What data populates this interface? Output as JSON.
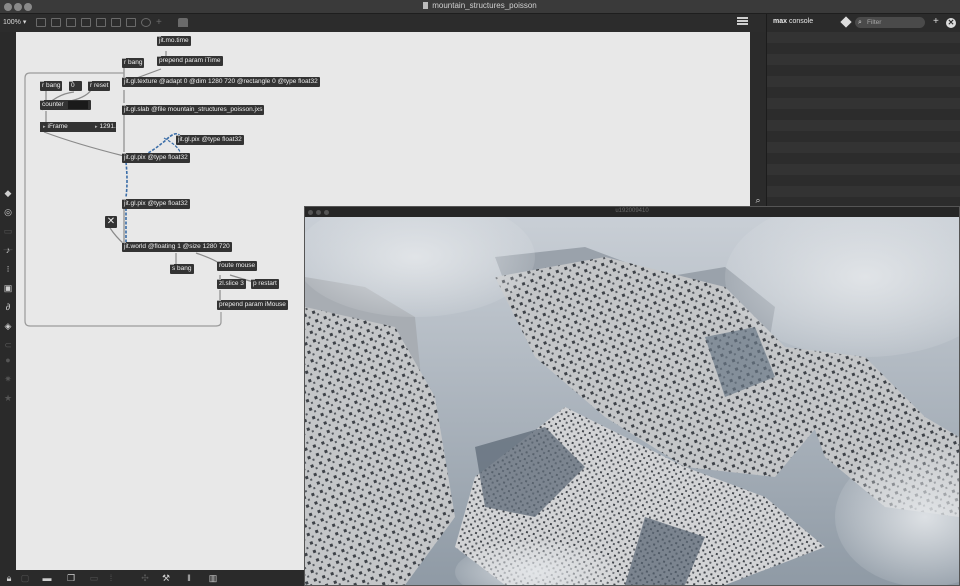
{
  "window": {
    "title": "mountain_structures_poisson"
  },
  "toolbar": {
    "zoom": "100%",
    "zoom_caret": "▾"
  },
  "patcher": {
    "objects": {
      "jit_mo_time": "jit.mo.time",
      "prepend_itime": "prepend param iTime",
      "r_bang_top": "r bang",
      "jit_gl_texture": "jit.gl.texture @adapt 0 @dim 1280 720 @rectangle 0 @type float32",
      "r_bang": "r bang",
      "num_zero": "0",
      "r_reset": "r reset",
      "counter": "counter",
      "jit_gl_slab": "jit.gl.slab @file mountain_structures_poisson.jxs",
      "iframe_label": "iFrame",
      "iframe_value": "1291.",
      "jit_gl_pix_a": "jit.gl.pix @type float32",
      "jit_gl_pix_b": "jit.gl.pix @type float32",
      "jit_gl_pix_c": "jit.gl.pix @type float32",
      "toggle": "✕",
      "jit_world": "jit.world @floating 1 @size 1280 720",
      "s_bang": "s bang",
      "route_mouse": "route mouse",
      "zl_slice": "zl.slice 3",
      "p_restart": "p restart",
      "prepend_imouse": "prepend param iMouse"
    }
  },
  "console": {
    "title_bold": "max",
    "title_rest": " console",
    "filter_placeholder": "Filter",
    "add_label": "+",
    "close_label": "✕",
    "search_glyph": "⌕"
  },
  "jit_window": {
    "title": "u192009410"
  },
  "colors": {
    "canvas_bg": "#e8e8e8",
    "object_bg": "#333333",
    "cord": "#8a8a8a",
    "signal_cord": "#3a6da8"
  }
}
